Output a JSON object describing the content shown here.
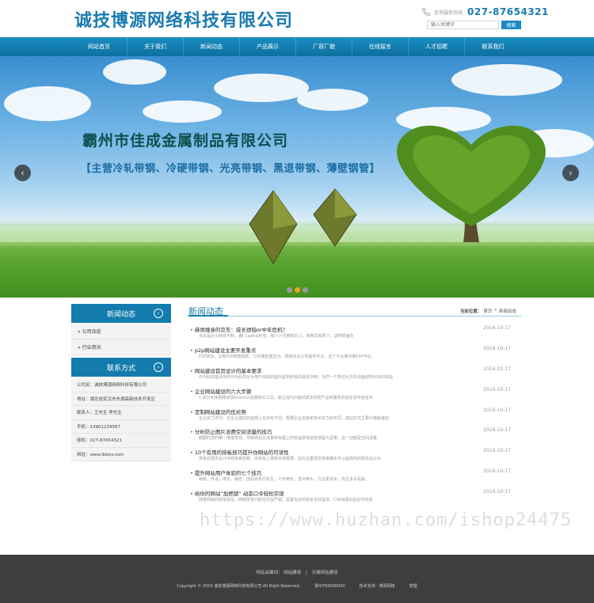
{
  "header": {
    "company_name": "诚技博源网络科技有限公司",
    "hotline_label": "咨询服务热线",
    "hotline_number": "027-87654321",
    "search_placeholder": "输入关键字",
    "search_button": "搜索"
  },
  "nav": {
    "items": [
      "网站首页",
      "关于我们",
      "新闻动态",
      "产品展示",
      "厂容厂貌",
      "在线留言",
      "人才招聘",
      "联系我们"
    ]
  },
  "banner": {
    "company": "霸州市佳成金属制品有限公司",
    "products": "【主营冷轧带钢、冷硬带钢、光亮带钢、黑退带钢、薄壁钢管】",
    "prev": "‹",
    "next": "›",
    "slide_count": 3,
    "active_slide": 2
  },
  "sidebar": {
    "news_heading": "新闻动态",
    "news_items": [
      "» 公司动态",
      "» 行业资讯"
    ],
    "contact_heading": "联系方式",
    "contact_rows": [
      "公司名：诚技博源网络科技有限公司",
      "地址：湖北省武汉市东湖高新技术开发区",
      "联系人：王先生 李先生",
      "手机：13901234567",
      "座机：027-87654321",
      "网址：www.lbboy.com"
    ]
  },
  "main": {
    "title": "新闻动态",
    "breadcrumb_label": "当前位置：",
    "breadcrumb_home": "首页",
    "breadcrumb_sep": ">",
    "breadcrumb_current": "新闻动态",
    "news": [
      {
        "title": "麻烦缠身的京东：成长烦恼or中年危机？",
        "date": "2016-10-17",
        "summary": "京东是近小麻烦不断，被J Capital盯空，和六六互撕暂扛上，和微贷商网了，这种局面在"
      },
      {
        "title": "p2p网站建设主要开发重点",
        "date": "2016-10-17",
        "summary": "P2P网贷，又称P2P网络借款。它的典型模式为，网络信贷公司提供平台，这个平台被叫做P2P平台。"
      },
      {
        "title": "网站建设首页设计的基本要求",
        "date": "2016-10-17",
        "summary": "作为好的首页布局与代码优化对用户体验的提升起到积极的促进作用，当然一个简洁大方的页面结构对SEO体验"
      },
      {
        "title": "企业网站建设的六大步骤",
        "date": "2016-10-17",
        "summary": "1.充分利用网络资源Internet是拥有约工具，能让给代价最低成本的把产品和服务的信息发布给全世"
      },
      {
        "title": "定制网站建设的优劣势",
        "date": "2016-10-17",
        "summary": "企业实力不同，在企业建站的选择上也多有不同。根据企业资金和技术实力的不同，建站方式主要分模板建站"
      },
      {
        "title": "分析防止图片浪费空间流量的技巧",
        "date": "2016-10-17",
        "summary": "截图时您的哪一堆很发现，导致网站在流量和标题上的收益即使是普通极为显著。这一切都是空间流量"
      },
      {
        "title": "10个有用的排板技巧提升你网站的可读性",
        "date": "2016-10-17",
        "summary": "排板在网页设计中经常被忽略，而实际上排板非常重要，因为注重网页排板确实可以提高你的网页设计水"
      },
      {
        "title": "提升网站用户体验的七个技巧",
        "date": "2016-10-17",
        "summary": "跨者，传递，搜达，解密，因而商务问先生，十年两天，直中两大，行业更进步，先生多多是属。"
      },
      {
        "title": "给你的网站“加把锁” 动态口令轻松实现",
        "date": "2016-10-17",
        "summary": "随着网络的逐渐普及，网络安全问题也日益严峻。黑客攻击的技术也日益加，CSDN源出后自作完成"
      }
    ]
  },
  "footer": {
    "links_label": "网站关键词：",
    "link1": "网站建设",
    "link2": "无锡网站建设",
    "copyright": "Copyright © 2016 诚技博源网络科技有限公司 All Right Reserved.",
    "icp": "鄂ICP00000000",
    "support": "技术支持：博源网络",
    "admin": "管理"
  },
  "watermark": "https://www.huzhan.com/ishop24475",
  "colors": {
    "brand": "#1a7bb0",
    "nav": "#137cad",
    "footer": "#3e3e3e",
    "active_dot": "#e8a422"
  }
}
